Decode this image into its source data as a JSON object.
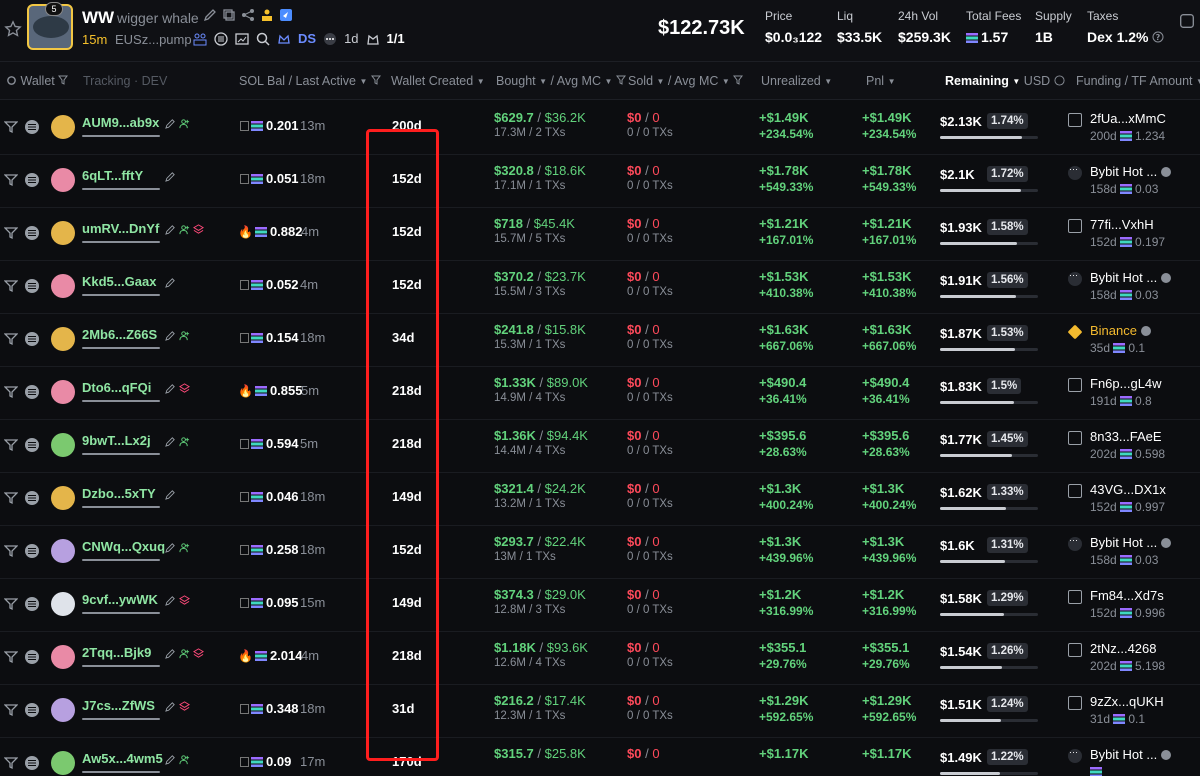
{
  "token": {
    "holders_badge": "5",
    "symbol": "WW",
    "name": "wigger whale",
    "age": "15m",
    "address": "EUSz...pump",
    "ds_label": "DS",
    "pair_age": "1d",
    "ratio": "1/1",
    "market_cap": "$122.73K"
  },
  "stats": [
    {
      "label": "Price",
      "value": "$0.0₃122"
    },
    {
      "label": "Liq",
      "value": "$33.5K"
    },
    {
      "label": "24h Vol",
      "value": "$259.3K"
    },
    {
      "label": "Total Fees",
      "value": "1.57"
    },
    {
      "label": "Supply",
      "value": "1B"
    },
    {
      "label": "Taxes",
      "value": "Dex 1.2%"
    }
  ],
  "columns": {
    "wallet": "Wallet",
    "tracking": "Tracking",
    "dev": "DEV",
    "sol_bal": "SOL Bal",
    "last_active": "Last Active",
    "wallet_created": "Wallet Created",
    "bought": "Bought",
    "avg_mc_1": "Avg MC",
    "sold": "Sold",
    "avg_mc_2": "Avg MC",
    "unrealized": "Unrealized",
    "pnl": "Pnl",
    "remaining": "Remaining",
    "usd": "USD",
    "funding": "Funding",
    "tf_amount": "TF Amount"
  },
  "rows": [
    {
      "wallet": "AUM9...ab9x",
      "fire": false,
      "sol": "0.201",
      "active": "13m",
      "created": "200d",
      "bought": "$629.7",
      "bought_mc": "$36.2K",
      "bought_sub": "17.3M / 2 TXs",
      "sold": "$0",
      "sold_mc": "0",
      "sold_sub": "0 / 0 TXs",
      "unr": "+$1.49K",
      "unr_pct": "+234.54%",
      "pnl": "+$1.49K",
      "pnl_pct": "+234.54%",
      "rem": "$2.13K",
      "rem_pct": "1.74%",
      "rem_fill": 0.84,
      "f_type": "wallet",
      "f_name": "2fUa...xMmC",
      "f_age": "200d",
      "f_amt": "1.234",
      "pfp": "#e4b54a"
    },
    {
      "wallet": "6qLT...fftY",
      "fire": false,
      "sol": "0.051",
      "active": "18m",
      "created": "152d",
      "bought": "$320.8",
      "bought_mc": "$18.6K",
      "bought_sub": "17.1M / 1 TXs",
      "sold": "$0",
      "sold_mc": "0",
      "sold_sub": "0 / 0 TXs",
      "unr": "+$1.78K",
      "unr_pct": "+549.33%",
      "pnl": "+$1.78K",
      "pnl_pct": "+549.33%",
      "rem": "$2.1K",
      "rem_pct": "1.72%",
      "rem_fill": 0.83,
      "f_type": "exch",
      "f_name": "Bybit Hot ...",
      "f_age": "158d",
      "f_amt": "0.03",
      "pfp": "#e98aa6"
    },
    {
      "wallet": "umRV...DnYf",
      "fire": true,
      "sol": "0.882",
      "active": "4m",
      "created": "152d",
      "bought": "$718",
      "bought_mc": "$45.4K",
      "bought_sub": "15.7M / 5 TXs",
      "sold": "$0",
      "sold_mc": "0",
      "sold_sub": "0 / 0 TXs",
      "unr": "+$1.21K",
      "unr_pct": "+167.01%",
      "pnl": "+$1.21K",
      "pnl_pct": "+167.01%",
      "rem": "$1.93K",
      "rem_pct": "1.58%",
      "rem_fill": 0.79,
      "f_type": "wallet",
      "f_name": "77fi...VxhH",
      "f_age": "152d",
      "f_amt": "0.197",
      "pfp": "#e4b54a"
    },
    {
      "wallet": "Kkd5...Gaax",
      "fire": false,
      "sol": "0.052",
      "active": "4m",
      "created": "152d",
      "bought": "$370.2",
      "bought_mc": "$23.7K",
      "bought_sub": "15.5M / 3 TXs",
      "sold": "$0",
      "sold_mc": "0",
      "sold_sub": "0 / 0 TXs",
      "unr": "+$1.53K",
      "unr_pct": "+410.38%",
      "pnl": "+$1.53K",
      "pnl_pct": "+410.38%",
      "rem": "$1.91K",
      "rem_pct": "1.56%",
      "rem_fill": 0.78,
      "f_type": "exch",
      "f_name": "Bybit Hot ...",
      "f_age": "158d",
      "f_amt": "0.03",
      "pfp": "#e98aa6"
    },
    {
      "wallet": "2Mb6...Z66S",
      "fire": false,
      "sol": "0.154",
      "active": "18m",
      "created": "34d",
      "bought": "$241.8",
      "bought_mc": "$15.8K",
      "bought_sub": "15.3M / 1 TXs",
      "sold": "$0",
      "sold_mc": "0",
      "sold_sub": "0 / 0 TXs",
      "unr": "+$1.63K",
      "unr_pct": "+667.06%",
      "pnl": "+$1.63K",
      "pnl_pct": "+667.06%",
      "rem": "$1.87K",
      "rem_pct": "1.53%",
      "rem_fill": 0.77,
      "f_type": "bnb",
      "f_name": "Binance",
      "f_age": "35d",
      "f_amt": "0.1",
      "pfp": "#e4b54a"
    },
    {
      "wallet": "Dto6...qFQi",
      "fire": true,
      "sol": "0.855",
      "active": "5m",
      "created": "218d",
      "bought": "$1.33K",
      "bought_mc": "$89.0K",
      "bought_sub": "14.9M / 4 TXs",
      "sold": "$0",
      "sold_mc": "0",
      "sold_sub": "0 / 0 TXs",
      "unr": "+$490.4",
      "unr_pct": "+36.41%",
      "pnl": "+$490.4",
      "pnl_pct": "+36.41%",
      "rem": "$1.83K",
      "rem_pct": "1.5%",
      "rem_fill": 0.75,
      "f_type": "wallet",
      "f_name": "Fn6p...gL4w",
      "f_age": "191d",
      "f_amt": "0.8",
      "pfp": "#e98aa6"
    },
    {
      "wallet": "9bwT...Lx2j",
      "fire": false,
      "sol": "0.594",
      "active": "5m",
      "created": "218d",
      "bought": "$1.36K",
      "bought_mc": "$94.4K",
      "bought_sub": "14.4M / 4 TXs",
      "sold": "$0",
      "sold_mc": "0",
      "sold_sub": "0 / 0 TXs",
      "unr": "+$395.6",
      "unr_pct": "+28.63%",
      "pnl": "+$395.6",
      "pnl_pct": "+28.63%",
      "rem": "$1.77K",
      "rem_pct": "1.45%",
      "rem_fill": 0.73,
      "f_type": "wallet",
      "f_name": "8n33...FAeE",
      "f_age": "202d",
      "f_amt": "0.598",
      "pfp": "#7bc96f"
    },
    {
      "wallet": "Dzbo...5xTY",
      "fire": false,
      "sol": "0.046",
      "active": "18m",
      "created": "149d",
      "bought": "$321.4",
      "bought_mc": "$24.2K",
      "bought_sub": "13.2M / 1 TXs",
      "sold": "$0",
      "sold_mc": "0",
      "sold_sub": "0 / 0 TXs",
      "unr": "+$1.3K",
      "unr_pct": "+400.24%",
      "pnl": "+$1.3K",
      "pnl_pct": "+400.24%",
      "rem": "$1.62K",
      "rem_pct": "1.33%",
      "rem_fill": 0.67,
      "f_type": "wallet",
      "f_name": "43VG...DX1x",
      "f_age": "152d",
      "f_amt": "0.997",
      "pfp": "#e4b54a"
    },
    {
      "wallet": "CNWq...Qxuq",
      "fire": false,
      "sol": "0.258",
      "active": "18m",
      "created": "152d",
      "bought": "$293.7",
      "bought_mc": "$22.4K",
      "bought_sub": "13M / 1 TXs",
      "sold": "$0",
      "sold_mc": "0",
      "sold_sub": "0 / 0 TXs",
      "unr": "+$1.3K",
      "unr_pct": "+439.96%",
      "pnl": "+$1.3K",
      "pnl_pct": "+439.96%",
      "rem": "$1.6K",
      "rem_pct": "1.31%",
      "rem_fill": 0.66,
      "f_type": "exch",
      "f_name": "Bybit Hot ...",
      "f_age": "158d",
      "f_amt": "0.03",
      "pfp": "#b7a0e0"
    },
    {
      "wallet": "9cvf...ywWK",
      "fire": false,
      "sol": "0.095",
      "active": "15m",
      "created": "149d",
      "bought": "$374.3",
      "bought_mc": "$29.0K",
      "bought_sub": "12.8M / 3 TXs",
      "sold": "$0",
      "sold_mc": "0",
      "sold_sub": "0 / 0 TXs",
      "unr": "+$1.2K",
      "unr_pct": "+316.99%",
      "pnl": "+$1.2K",
      "pnl_pct": "+316.99%",
      "rem": "$1.58K",
      "rem_pct": "1.29%",
      "rem_fill": 0.65,
      "f_type": "wallet",
      "f_name": "Fm84...Xd7s",
      "f_age": "152d",
      "f_amt": "0.996",
      "pfp": "#dfe3ea"
    },
    {
      "wallet": "2Tqq...Bjk9",
      "fire": true,
      "sol": "2.014",
      "active": "4m",
      "created": "218d",
      "bought": "$1.18K",
      "bought_mc": "$93.6K",
      "bought_sub": "12.6M / 4 TXs",
      "sold": "$0",
      "sold_mc": "0",
      "sold_sub": "0 / 0 TXs",
      "unr": "+$355.1",
      "unr_pct": "+29.76%",
      "pnl": "+$355.1",
      "pnl_pct": "+29.76%",
      "rem": "$1.54K",
      "rem_pct": "1.26%",
      "rem_fill": 0.63,
      "f_type": "wallet",
      "f_name": "2tNz...4268",
      "f_age": "202d",
      "f_amt": "5.198",
      "pfp": "#e98aa6"
    },
    {
      "wallet": "J7cs...ZfWS",
      "fire": false,
      "sol": "0.348",
      "active": "18m",
      "created": "31d",
      "bought": "$216.2",
      "bought_mc": "$17.4K",
      "bought_sub": "12.3M / 1 TXs",
      "sold": "$0",
      "sold_mc": "0",
      "sold_sub": "0 / 0 TXs",
      "unr": "+$1.29K",
      "unr_pct": "+592.65%",
      "pnl": "+$1.29K",
      "pnl_pct": "+592.65%",
      "rem": "$1.51K",
      "rem_pct": "1.24%",
      "rem_fill": 0.62,
      "f_type": "wallet",
      "f_name": "9zZx...qUKH",
      "f_age": "31d",
      "f_amt": "0.1",
      "pfp": "#b7a0e0"
    },
    {
      "wallet": "Aw5x...4wm5",
      "fire": false,
      "sol": "0.09",
      "active": "17m",
      "created": "170d",
      "bought": "$315.7",
      "bought_mc": "$25.8K",
      "bought_sub": "",
      "sold": "$0",
      "sold_mc": "0",
      "sold_sub": "",
      "unr": "+$1.17K",
      "unr_pct": "",
      "pnl": "+$1.17K",
      "pnl_pct": "",
      "rem": "$1.49K",
      "rem_pct": "1.22%",
      "rem_fill": 0.61,
      "f_type": "exch",
      "f_name": "Bybit Hot ...",
      "f_age": "",
      "f_amt": "",
      "pfp": "#7bc96f",
      "cut": true
    }
  ],
  "colors": {
    "green": "#62d27c",
    "red": "#ff4a5b",
    "accent": "#f5c02b",
    "highlight": "#ff1e1e"
  }
}
